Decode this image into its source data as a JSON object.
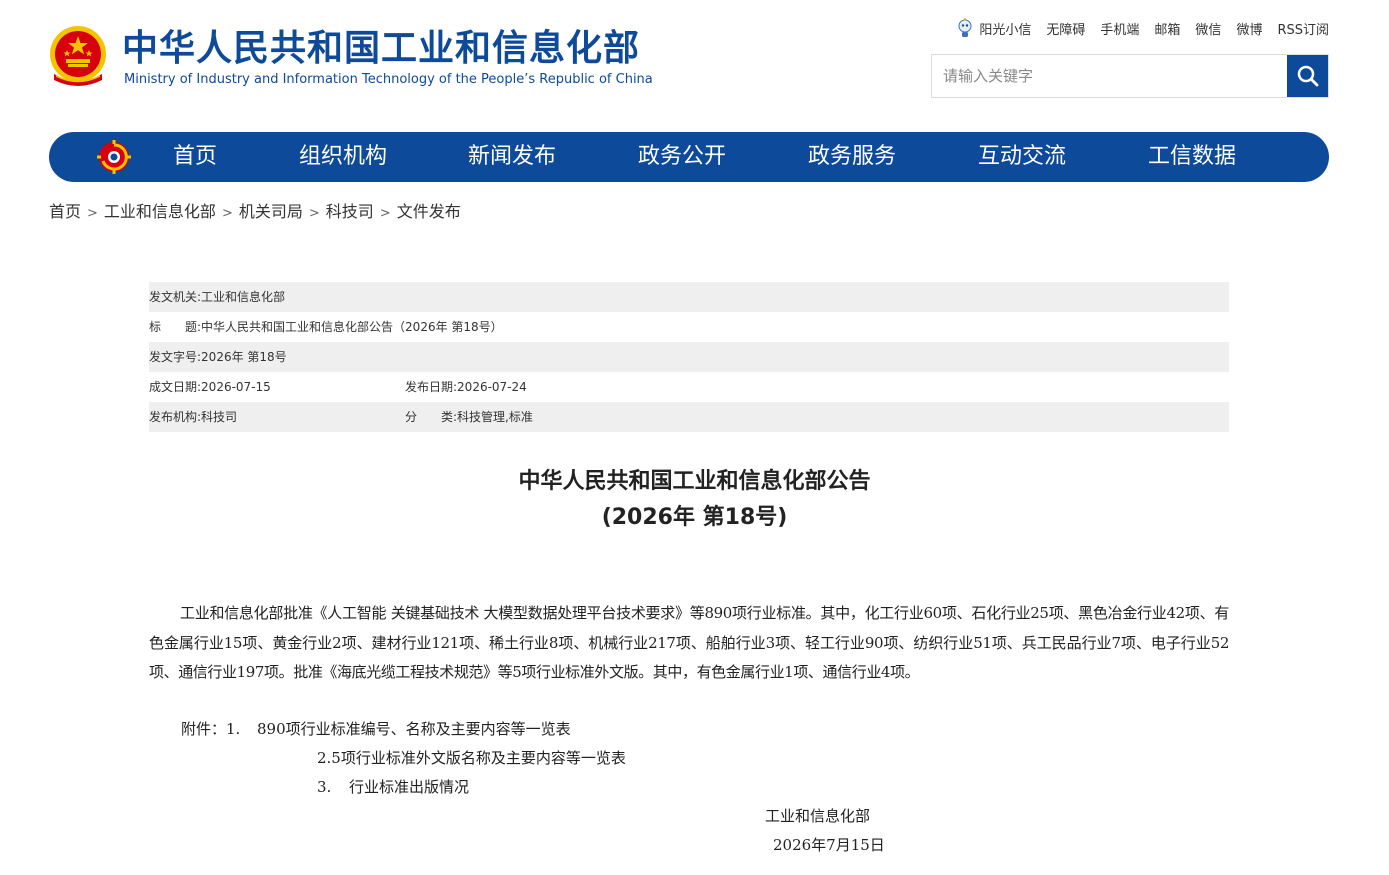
{
  "header": {
    "title_cn": "中华人民共和国工业和信息化部",
    "title_en": "Ministry of Industry and Information Technology of the People’s Republic of China",
    "emblem_icon": "national-emblem-icon"
  },
  "toplinks": [
    {
      "label": "阳光小信",
      "icon": "robot-icon"
    },
    {
      "label": "无障碍"
    },
    {
      "label": "手机端"
    },
    {
      "label": "邮箱"
    },
    {
      "label": "微信"
    },
    {
      "label": "微博"
    },
    {
      "label": "RSS订阅"
    }
  ],
  "search": {
    "placeholder": "请输入关键字",
    "value": "",
    "icon": "search-icon"
  },
  "nav": {
    "logo_icon": "ministry-logo-icon",
    "items": [
      "首页",
      "组织机构",
      "新闻发布",
      "政务公开",
      "政务服务",
      "互动交流",
      "工信数据"
    ]
  },
  "breadcrumb": [
    "首页",
    "工业和信息化部",
    "机关司局",
    "科技司",
    "文件发布"
  ],
  "meta": {
    "issuer_label": "发文机关:",
    "issuer": "工业和信息化部",
    "title_label": "标　　题:",
    "title": "中华人民共和国工业和信息化部公告（2026年 第18号）",
    "docno_label": "发文字号:",
    "docno": "2026年 第18号",
    "created_label": "成文日期:",
    "created": "2026-07-15",
    "published_label": "发布日期:",
    "published": "2026-07-24",
    "org_label": "发布机构:",
    "org": "科技司",
    "category_label": "分　　类:",
    "category": "科技管理,标准"
  },
  "article": {
    "title_line1": "中华人民共和国工业和信息化部公告",
    "title_line2": "(2026年 第18号)",
    "body": "工业和信息化部批准《人工智能 关键基础技术 大模型数据处理平台技术要求》等890项行业标准。其中，化工行业60项、石化行业25项、黑色冶金行业42项、有色金属行业15项、黄金行业2项、建材行业121项、稀土行业8项、机械行业217项、船舶行业3项、轻工行业90项、纺织行业51项、兵工民品行业7项、电子行业52项、通信行业197项。批准《海底光缆工程技术规范》等5项行业标准外文版。其中，有色金属行业1项、通信行业4项。",
    "attachments_label": "附件：",
    "attachments": [
      {
        "num": "1.",
        "text": "890项行业标准编号、名称及主要内容等一览表"
      },
      {
        "num": "",
        "text": "2.5项行业标准外文版名称及主要内容等一览表"
      },
      {
        "num": "3.",
        "text": "行业标准出版情况"
      }
    ],
    "signature": "工业和信息化部",
    "date": "2026年7月15日"
  },
  "colors": {
    "brand_blue": "#0d4a9a",
    "emblem_red": "#d7000f",
    "emblem_gold": "#f5c400",
    "meta_shade": "#efefef"
  }
}
